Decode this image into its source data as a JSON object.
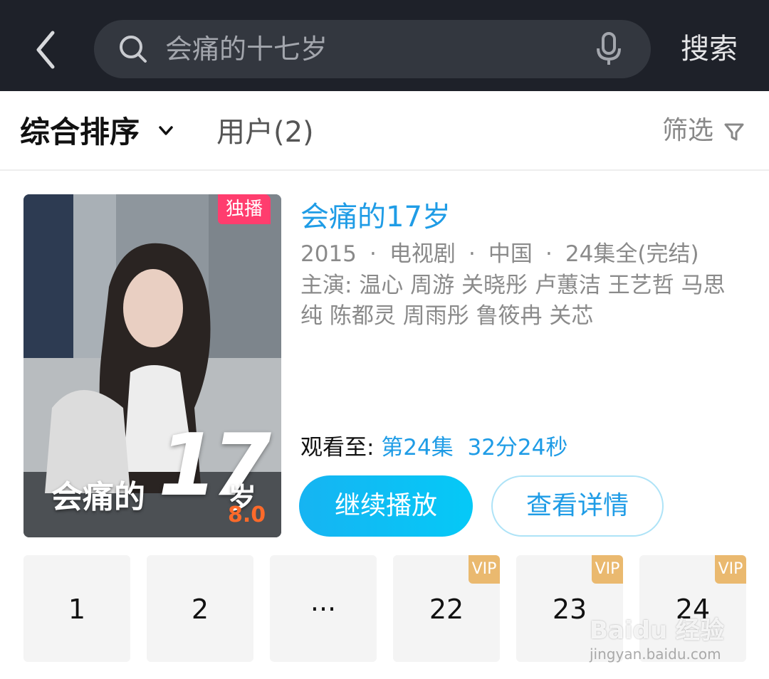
{
  "search": {
    "query": "会痛的十七岁",
    "button_label": "搜索"
  },
  "filters": {
    "sort_label": "综合排序",
    "users_tab": "用户(2)",
    "filter_label": "筛选"
  },
  "result": {
    "exclusive_badge": "独播",
    "poster_title": "会痛的",
    "poster_number": "17",
    "poster_suffix": "岁",
    "rating": "8.0",
    "title": "会痛的17岁",
    "year": "2015",
    "type": "电视剧",
    "region": "中国",
    "episodes_status": "24集全(完结)",
    "meta_separator": "·",
    "cast": "主演: 温心 周游 关晓彤 卢蕙洁 王艺哲 马思纯 陈都灵 周雨彤 鲁筱冉 关芯",
    "watch_prefix": "观看至: ",
    "watch_episode": "第24集",
    "watch_time": "32分24秒",
    "play_button": "继续播放",
    "detail_button": "查看详情"
  },
  "episodes": [
    {
      "label": "1",
      "vip": false
    },
    {
      "label": "2",
      "vip": false
    },
    {
      "label": "···",
      "vip": false
    },
    {
      "label": "22",
      "vip": true
    },
    {
      "label": "23",
      "vip": true
    },
    {
      "label": "24",
      "vip": true
    }
  ],
  "vip_label": "VIP",
  "watermark": {
    "logo": "Baidu 经验",
    "url": "jingyan.baidu.com"
  },
  "colors": {
    "topbar": "#1e2129",
    "accent_blue": "#1f9ce6",
    "exclusive_pink": "#ff3d6e",
    "vip_gold": "#eab96f",
    "rating_orange": "#ff6a2a"
  },
  "icons": [
    "back-icon",
    "search-icon",
    "microphone-icon",
    "chevron-down-icon",
    "filter-icon"
  ]
}
